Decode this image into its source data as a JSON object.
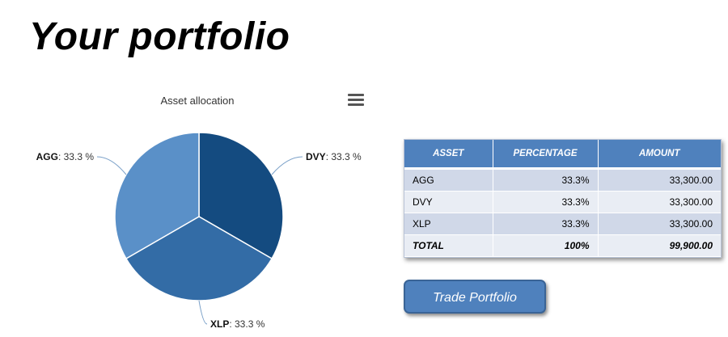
{
  "page": {
    "title": "Your portfolio"
  },
  "chart_data": {
    "type": "pie",
    "title": "Asset allocation",
    "slices": [
      {
        "name": "DVY",
        "value": 33.3,
        "label_suffix": ": 33.3 %",
        "color": "#144b80"
      },
      {
        "name": "XLP",
        "value": 33.3,
        "label_suffix": ": 33.3 %",
        "color": "#336ca6"
      },
      {
        "name": "AGG",
        "value": 33.3,
        "label_suffix": ": 33.3 %",
        "color": "#5a90c8"
      }
    ],
    "menu_icon": "hamburger-menu-icon"
  },
  "table": {
    "headers": [
      "ASSET",
      "PERCENTAGE",
      "AMOUNT"
    ],
    "rows": [
      {
        "asset": "AGG",
        "percentage": "33.3%",
        "amount": "33,300.00"
      },
      {
        "asset": "DVY",
        "percentage": "33.3%",
        "amount": "33,300.00"
      },
      {
        "asset": "XLP",
        "percentage": "33.3%",
        "amount": "33,300.00"
      }
    ],
    "total": {
      "asset": "TOTAL",
      "percentage": "100%",
      "amount": "99,900.00"
    }
  },
  "actions": {
    "trade_label": "Trade Portfolio"
  },
  "colors": {
    "header_blue": "#4f81bd",
    "row_odd": "#d0d8e8",
    "row_even": "#e9edf4"
  }
}
